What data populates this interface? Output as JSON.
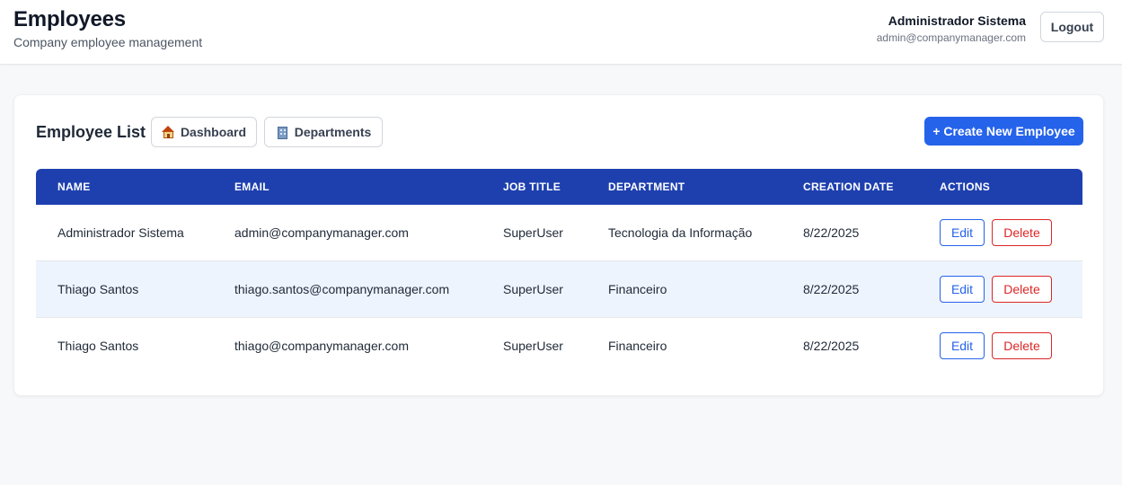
{
  "header": {
    "title": "Employees",
    "subtitle": "Company employee management",
    "user_name": "Administrador Sistema",
    "user_email": "admin@companymanager.com",
    "logout_label": "Logout"
  },
  "toolbar": {
    "title": "Employee List",
    "dashboard_label": "Dashboard",
    "dashboard_icon": "house-icon",
    "departments_label": "Departments",
    "departments_icon": "office-building-icon",
    "create_label": "+ Create New Employee"
  },
  "table": {
    "columns": [
      "NAME",
      "EMAIL",
      "JOB TITLE",
      "DEPARTMENT",
      "CREATION DATE",
      "ACTIONS"
    ],
    "edit_label": "Edit",
    "delete_label": "Delete",
    "rows": [
      {
        "name": "Administrador Sistema",
        "email": "admin@companymanager.com",
        "job_title": "SuperUser",
        "department": "Tecnologia da Informação",
        "creation_date": "8/22/2025"
      },
      {
        "name": "Thiago Santos",
        "email": "thiago.santos@companymanager.com",
        "job_title": "SuperUser",
        "department": "Financeiro",
        "creation_date": "8/22/2025"
      },
      {
        "name": "Thiago Santos",
        "email": "thiago@companymanager.com",
        "job_title": "SuperUser",
        "department": "Financeiro",
        "creation_date": "8/22/2025"
      }
    ]
  },
  "colors": {
    "primary": "#2563eb",
    "table_header": "#1e40af",
    "danger": "#dc2626",
    "row_highlight": "#eef4fe"
  }
}
